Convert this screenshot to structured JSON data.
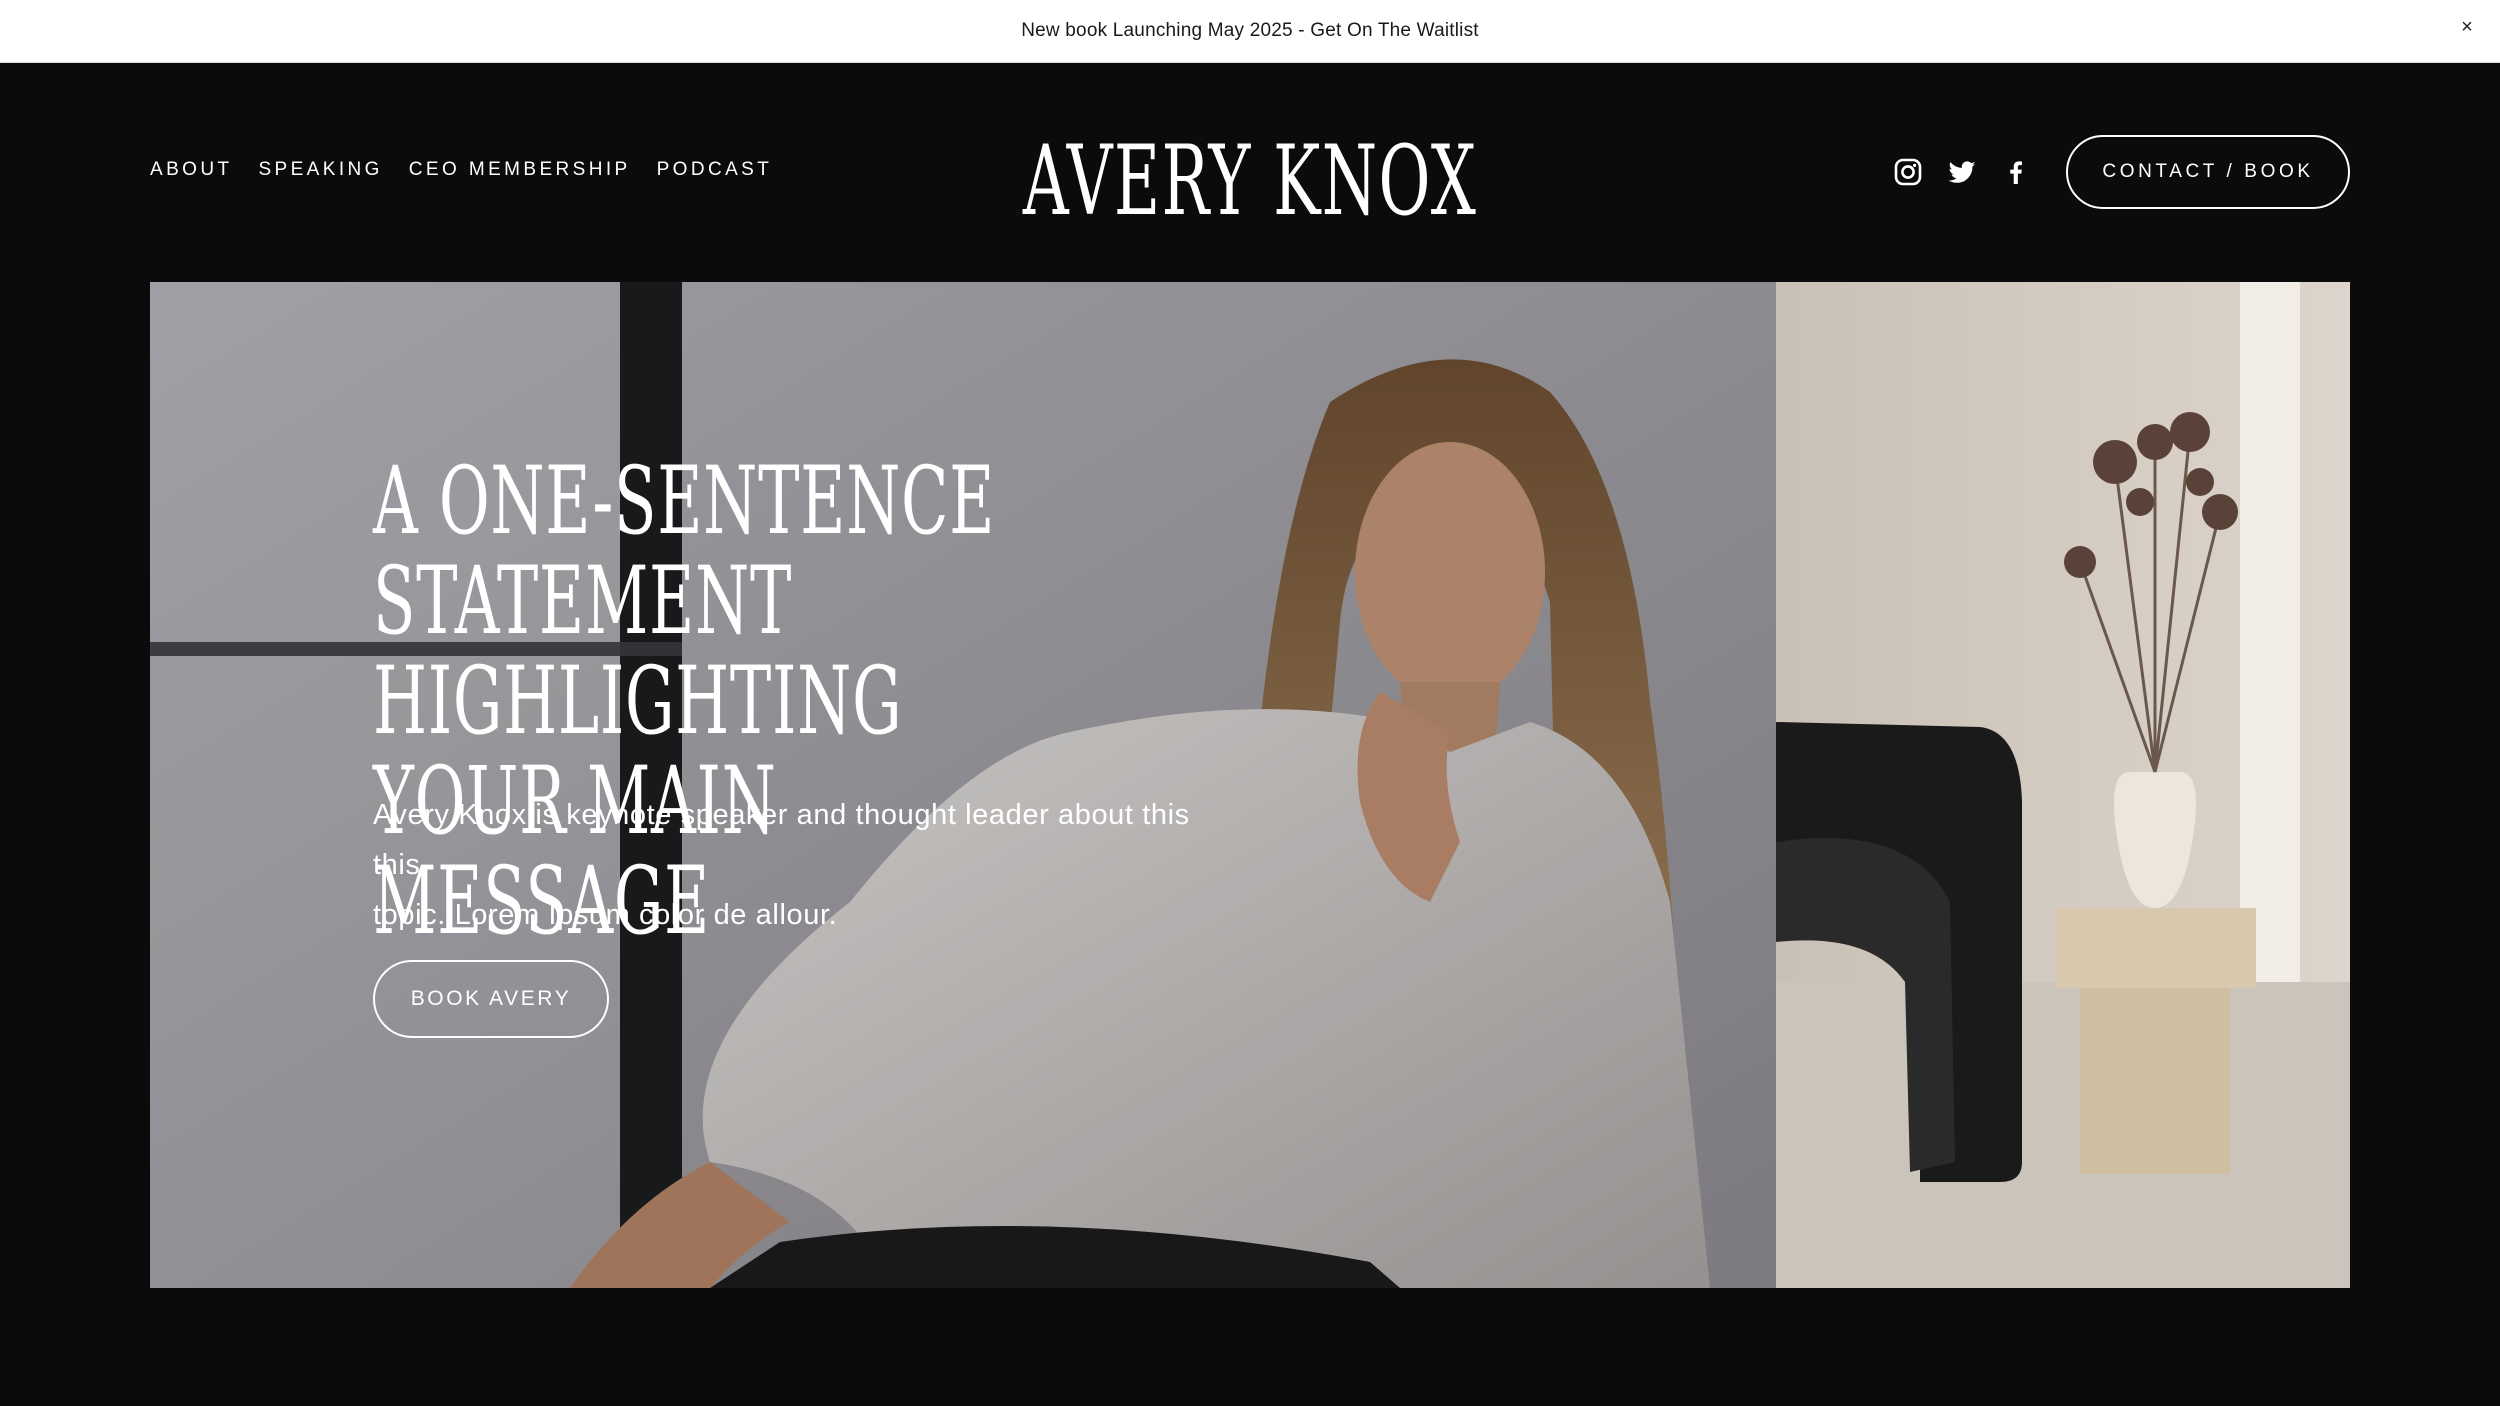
{
  "announcement": {
    "text": "New book Launching May 2025 - Get On The Waitlist",
    "close_icon": "×"
  },
  "header": {
    "nav": [
      "ABOUT",
      "SPEAKING",
      "CEO MEMBERSHIP",
      "PODCAST"
    ],
    "logo": "AVERY KNOX",
    "social_icons": [
      "instagram-icon",
      "twitter-icon",
      "facebook-icon"
    ],
    "cta_label": "CONTACT / BOOK"
  },
  "hero": {
    "heading_line1": "A ONE-SENTENCE STATEMENT",
    "heading_line2": "HIGHLIGHTING YOUR MAIN",
    "heading_line3": "MESSAGE",
    "subtext_line1": "Avery Knox is keynote speaker and thought leader about this this",
    "subtext_line2": "topic. Lorem Ipsum color de allour.",
    "button_label": "BOOK AVERY"
  },
  "colors": {
    "background": "#0b0b0b",
    "announcement_bg": "#ffffff",
    "text_light": "#ffffff",
    "text_dark": "#1a1a1a"
  }
}
